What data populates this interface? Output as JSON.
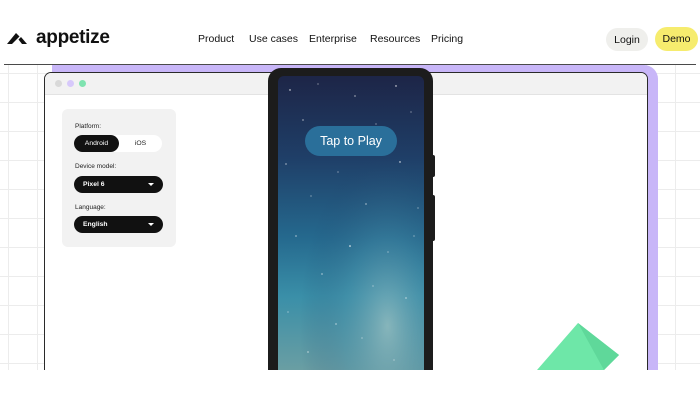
{
  "brand": {
    "name": "appetize",
    "logo_icon": "appetize-chevron-logo"
  },
  "nav": {
    "items": [
      "Product",
      "Use cases",
      "Enterprise",
      "Resources",
      "Pricing"
    ]
  },
  "header_actions": {
    "login_label": "Login",
    "demo_label": "Demo",
    "demo_color": "#f6ec6e"
  },
  "panel": {
    "platform_label": "Platform:",
    "platform_options": [
      "Android",
      "iOS"
    ],
    "platform_selected": "Android",
    "device_label": "Device model:",
    "device_value": "Pixel 6",
    "language_label": "Language:",
    "language_value": "English"
  },
  "phone": {
    "tap_label": "Tap to Play"
  },
  "colors": {
    "accent_purple": "#c8b6f8",
    "accent_green": "#6ee7a8",
    "screen_top": "#1d2547",
    "screen_bottom": "#6a9ea3"
  }
}
